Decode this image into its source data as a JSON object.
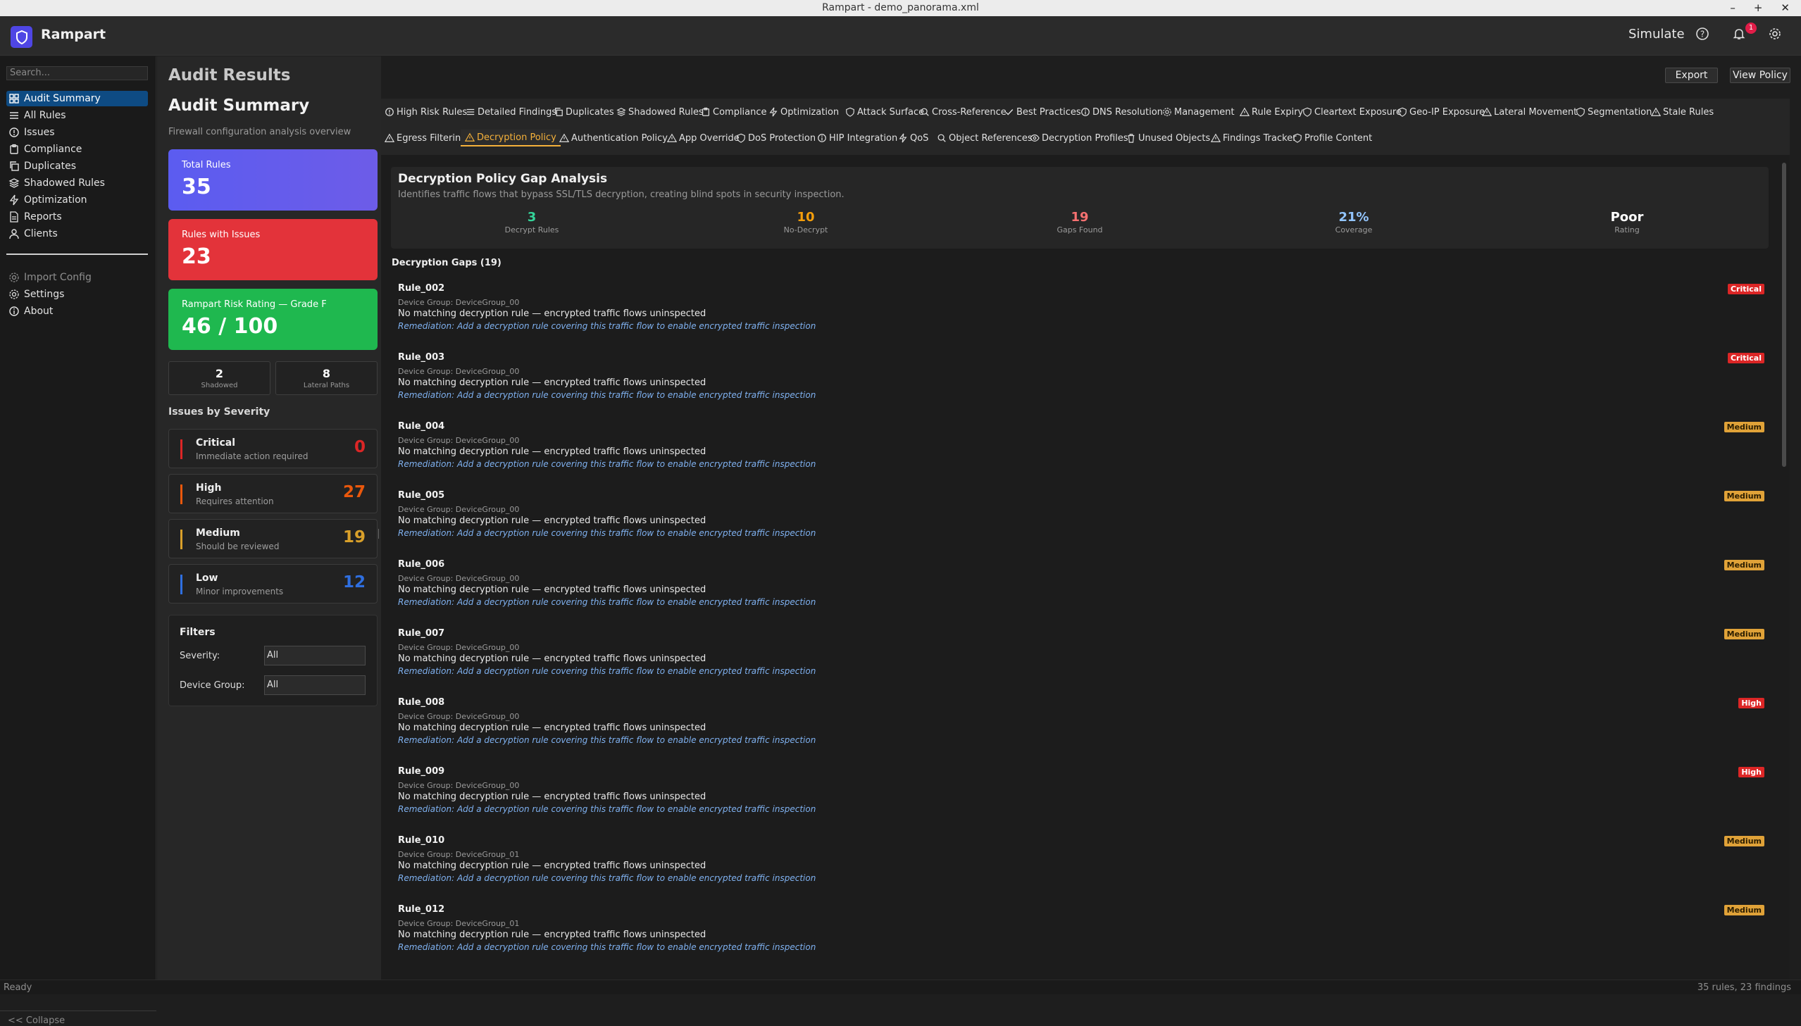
{
  "window": {
    "title": "Rampart - demo_panorama.xml"
  },
  "app": {
    "name": "Rampart",
    "simulate": "Simulate",
    "notif_count": "1"
  },
  "sidebar": {
    "search_placeholder": "Search...",
    "items": [
      {
        "label": "Audit Summary",
        "icon": "grid-icon"
      },
      {
        "label": "All Rules",
        "icon": "list-icon"
      },
      {
        "label": "Issues",
        "icon": "alert-circle-icon"
      },
      {
        "label": "Compliance",
        "icon": "clipboard-icon"
      },
      {
        "label": "Duplicates",
        "icon": "copy-icon"
      },
      {
        "label": "Shadowed Rules",
        "icon": "layers-icon"
      },
      {
        "label": "Optimization",
        "icon": "lightning-icon"
      },
      {
        "label": "Reports",
        "icon": "document-icon"
      },
      {
        "label": "Clients",
        "icon": "user-icon"
      }
    ],
    "secondary": [
      {
        "label": "Import Config",
        "icon": "gear-icon"
      },
      {
        "label": "Settings",
        "icon": "gear-icon"
      },
      {
        "label": "About",
        "icon": "info-icon"
      }
    ],
    "collapse": "<< Collapse"
  },
  "summary": {
    "heading": "Audit Results",
    "title": "Audit Summary",
    "subtitle": "Firewall configuration analysis overview",
    "total_label": "Total Rules",
    "total_value": "35",
    "issues_label": "Rules with Issues",
    "issues_value": "23",
    "risk_label": "Rampart Risk Rating — Grade F",
    "risk_value": "46 / 100",
    "shadowed_value": "2",
    "shadowed_label": "Shadowed",
    "lateral_value": "8",
    "lateral_label": "Lateral Paths",
    "severity_heading": "Issues by Severity",
    "severity": [
      {
        "name": "Critical",
        "desc": "Immediate action required",
        "count": "0",
        "color": "#dc2626"
      },
      {
        "name": "High",
        "desc": "Requires attention",
        "count": "27",
        "color": "#ea580c"
      },
      {
        "name": "Medium",
        "desc": "Should be reviewed",
        "count": "19",
        "color": "#d9a02a"
      },
      {
        "name": "Low",
        "desc": "Minor improvements",
        "count": "12",
        "color": "#2f6fe0"
      }
    ],
    "filters": {
      "title": "Filters",
      "severity_label": "Severity:",
      "severity_value": "All",
      "group_label": "Device Group:",
      "group_value": "All"
    }
  },
  "toolbar": {
    "export": "Export",
    "view_policy": "View Policy"
  },
  "tabs_row1": [
    "High Risk Rules",
    "Detailed Findings",
    "Duplicates",
    "Shadowed Rules",
    "Compliance",
    "Optimization",
    "Attack Surface",
    "Cross-Reference",
    "Best Practices",
    "DNS Resolution",
    "Management",
    "Rule Expiry",
    "Cleartext Exposure",
    "Geo-IP Exposure",
    "Lateral Movement",
    "Segmentation",
    "Stale Rules"
  ],
  "tabs_row2": [
    "Egress Filtering",
    "Decryption Policy",
    "Authentication Policy",
    "App Override",
    "DoS Protection",
    "HIP Integration",
    "QoS",
    "Object References",
    "Decryption Profiles",
    "Unused Objects",
    "Findings Tracker",
    "Profile Content"
  ],
  "decryption": {
    "title": "Decryption Policy Gap Analysis",
    "subtitle": "Identifies traffic flows that bypass SSL/TLS decryption, creating blind spots in security inspection.",
    "stats": [
      {
        "value": "3",
        "caption": "Decrypt Rules",
        "color": "#34d399"
      },
      {
        "value": "10",
        "caption": "No-Decrypt",
        "color": "#f59e0b"
      },
      {
        "value": "19",
        "caption": "Gaps Found",
        "color": "#f87171"
      },
      {
        "value": "21%",
        "caption": "Coverage",
        "color": "#93c5fd"
      },
      {
        "value": "Poor",
        "caption": "Rating",
        "color": "#ffffff"
      }
    ],
    "gaps_heading": "Decryption Gaps (19)",
    "gaps": [
      {
        "rule": "Rule_002",
        "group": "Device Group: DeviceGroup_00",
        "sev": "Critical",
        "cls": "crit"
      },
      {
        "rule": "Rule_003",
        "group": "Device Group: DeviceGroup_00",
        "sev": "Critical",
        "cls": "crit"
      },
      {
        "rule": "Rule_004",
        "group": "Device Group: DeviceGroup_00",
        "sev": "Medium",
        "cls": "med"
      },
      {
        "rule": "Rule_005",
        "group": "Device Group: DeviceGroup_00",
        "sev": "Medium",
        "cls": "med"
      },
      {
        "rule": "Rule_006",
        "group": "Device Group: DeviceGroup_00",
        "sev": "Medium",
        "cls": "med"
      },
      {
        "rule": "Rule_007",
        "group": "Device Group: DeviceGroup_00",
        "sev": "Medium",
        "cls": "med"
      },
      {
        "rule": "Rule_008",
        "group": "Device Group: DeviceGroup_00",
        "sev": "High",
        "cls": "high"
      },
      {
        "rule": "Rule_009",
        "group": "Device Group: DeviceGroup_00",
        "sev": "High",
        "cls": "high"
      },
      {
        "rule": "Rule_010",
        "group": "Device Group: DeviceGroup_01",
        "sev": "Medium",
        "cls": "med"
      },
      {
        "rule": "Rule_012",
        "group": "Device Group: DeviceGroup_01",
        "sev": "Medium",
        "cls": "med"
      }
    ],
    "gap_message": "No matching decryption rule — encrypted traffic flows uninspected",
    "gap_remediation": "Remediation: Add a decryption rule covering this traffic flow to enable encrypted traffic inspection"
  },
  "status": {
    "left": "Ready",
    "right": "35 rules, 23 findings"
  }
}
